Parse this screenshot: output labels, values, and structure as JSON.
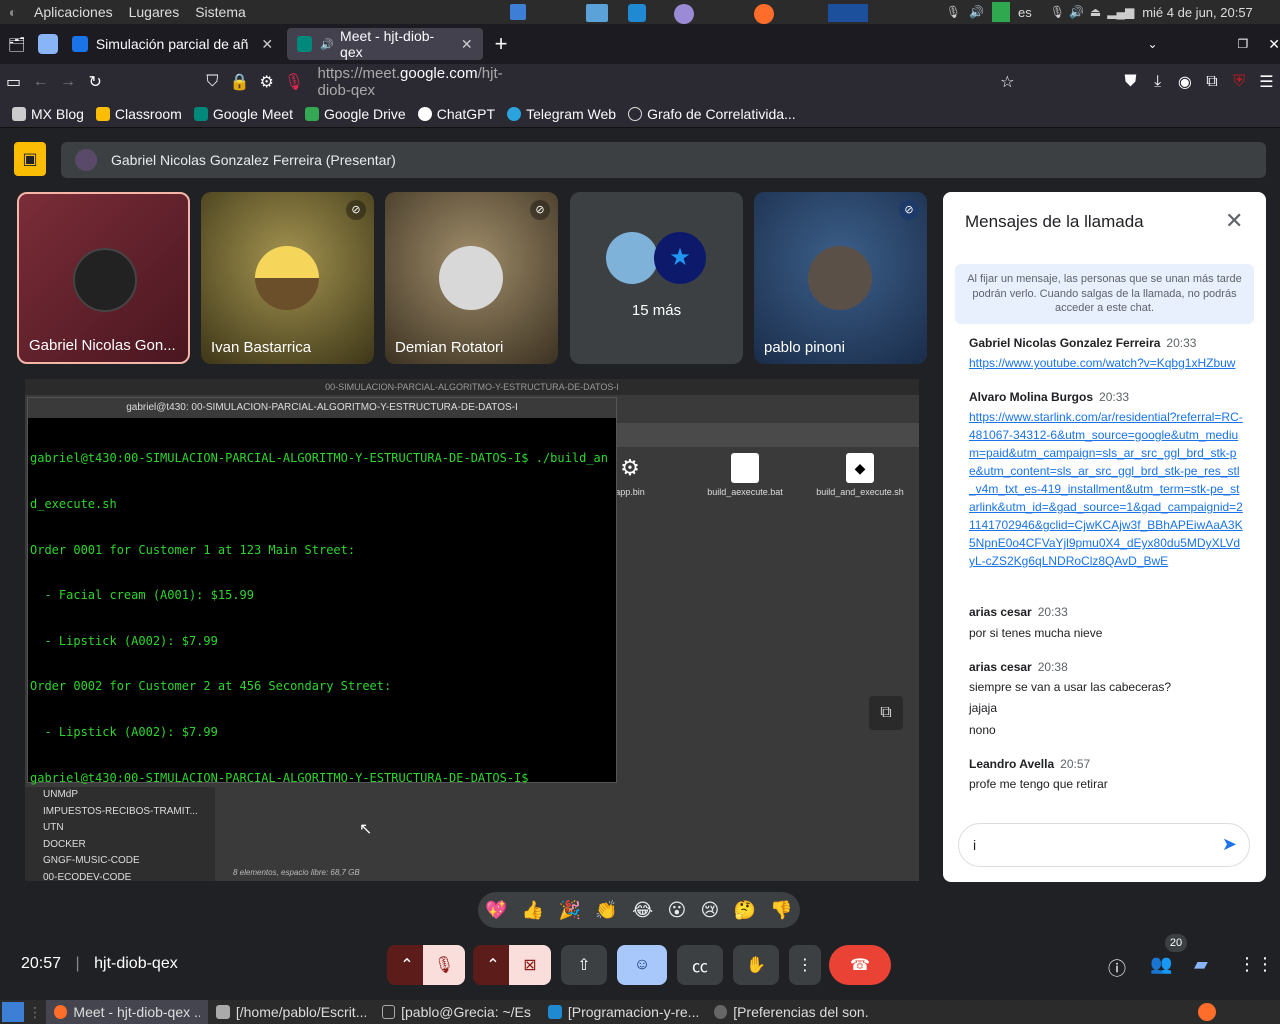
{
  "system": {
    "menus": [
      "Aplicaciones",
      "Lugares",
      "Sistema"
    ],
    "keyboard_layout": "es",
    "clock": "mié  4 de jun, 20:57"
  },
  "browser": {
    "tabs": [
      {
        "title": "Simulación parcial de añ",
        "active": false
      },
      {
        "title": "Meet - hjt-diob-qex",
        "active": true
      }
    ],
    "new_tab": "+",
    "url_prefix": "https://meet.",
    "url_domain": "google.com",
    "url_suffix": "/hjt-diob-qex",
    "bookmarks": [
      "MX Blog",
      "Classroom",
      "Google Meet",
      "Google Drive",
      "ChatGPT",
      "Telegram Web",
      "Grafo de Correlativida..."
    ]
  },
  "meet": {
    "presenter_label": "Gabriel Nicolas Gonzalez Ferreira (Presentar)",
    "participants": [
      {
        "name": "Gabriel Nicolas Gon...",
        "muted": false
      },
      {
        "name": "Ivan Bastarrica",
        "muted": true
      },
      {
        "name": "Demian Rotatori",
        "muted": true
      },
      {
        "name": "15 más",
        "muted": false
      },
      {
        "name": "pablo pinoni",
        "muted": true
      }
    ],
    "meeting_time": "20:57",
    "meeting_code": "hjt-diob-qex",
    "participants_count": "20",
    "reactions": [
      "💖",
      "👍",
      "🎉",
      "👏",
      "😂",
      "😮",
      "😢",
      "🤔",
      "👎"
    ]
  },
  "shared_screen": {
    "filemanager_title": "00-SIMULACION-PARCIAL-ALGORITMO-Y-ESTRUCTURA-DE-DATOS-I",
    "terminal_title": "gabriel@t430: 00-SIMULACION-PARCIAL-ALGORITMO-Y-ESTRUCTURA-DE-DATOS-I",
    "terminal_lines": [
      "gabriel@t430:00-SIMULACION-PARCIAL-ALGORITMO-Y-ESTRUCTURA-DE-DATOS-I$ ./build_an",
      "d_execute.sh",
      "Order 0001 for Customer 1 at 123 Main Street:",
      "  - Facial cream (A001): $15.99",
      "  - Lipstick (A002): $7.99",
      "Order 0002 for Customer 2 at 456 Secondary Street:",
      "  - Lipstick (A002): $7.99",
      "gabriel@t430:00-SIMULACION-PARCIAL-ALGORITMO-Y-ESTRUCTURA-DE-DATOS-I$ "
    ],
    "files": [
      "app.bin",
      "build_aexecute.bat",
      "build_and_execute.sh"
    ],
    "sidebar": [
      "UNMdP",
      "IMPUESTOS-RECIBOS-TRAMIT...",
      "UTN",
      "DOCKER",
      "GNGF-MUSIC-CODE",
      "00-ECODEV-CODE"
    ],
    "status": "8 elementos, espacio libre: 68,7 GB"
  },
  "chat": {
    "title": "Mensajes de la llamada",
    "info": "Al fijar un mensaje, las personas que se unan más tarde podrán verlo. Cuando salgas de la llamada, no podrás acceder a este chat.",
    "messages": [
      {
        "sender": "Gabriel Nicolas Gonzalez Ferreira",
        "time": "20:33",
        "texts": [
          "https://www.youtube.com/watch?v=Kqbg1xHZbuw"
        ],
        "link": true
      },
      {
        "sender": "Alvaro Molina Burgos",
        "time": "20:33",
        "texts": [
          "https://www.starlink.com/ar/residential?referral=RC-481067-34312-6&utm_source=google&utm_medium=paid&utm_campaign=sls_ar_src_ggl_brd_stk-pe&utm_content=sls_ar_src_ggl_brd_stk-pe_res_stl_v4m_txt_es-419_installment&utm_term=stk-pe_starlink&utm_id=&gad_source=1&gad_campaignid=21141702946&gclid=CjwKCAjw3f_BBhAPEiwAaA3K5NpnE0o4CFVaYjl9pmu0X4_dEyx80du5MDyXLVdyL-cZS2Kg6qLNDRoClz8QAvD_BwE"
        ],
        "link": true
      },
      {
        "sender": "arias cesar",
        "time": "20:33",
        "texts": [
          "por si tenes mucha nieve"
        ],
        "link": false
      },
      {
        "sender": "arias cesar",
        "time": "20:38",
        "texts": [
          "siempre se van a usar las cabeceras?",
          "jajaja",
          "nono"
        ],
        "link": false
      },
      {
        "sender": "Leandro Avella",
        "time": "20:57",
        "texts": [
          "profe me tengo que retirar"
        ],
        "link": false
      }
    ],
    "input_value": "i"
  },
  "taskbar": {
    "items": [
      "Meet - hjt-diob-qex ...",
      "[/home/pablo/Escrit...",
      "[pablo@Grecia: ~/Es...",
      "[Programacion-y-re...",
      "[Preferencias del son..."
    ]
  },
  "colors": {
    "accent": "#1a73e8",
    "end_call": "#ea4335",
    "presenter_yellow": "#fbbc04",
    "muted_red": "#f28b82"
  }
}
